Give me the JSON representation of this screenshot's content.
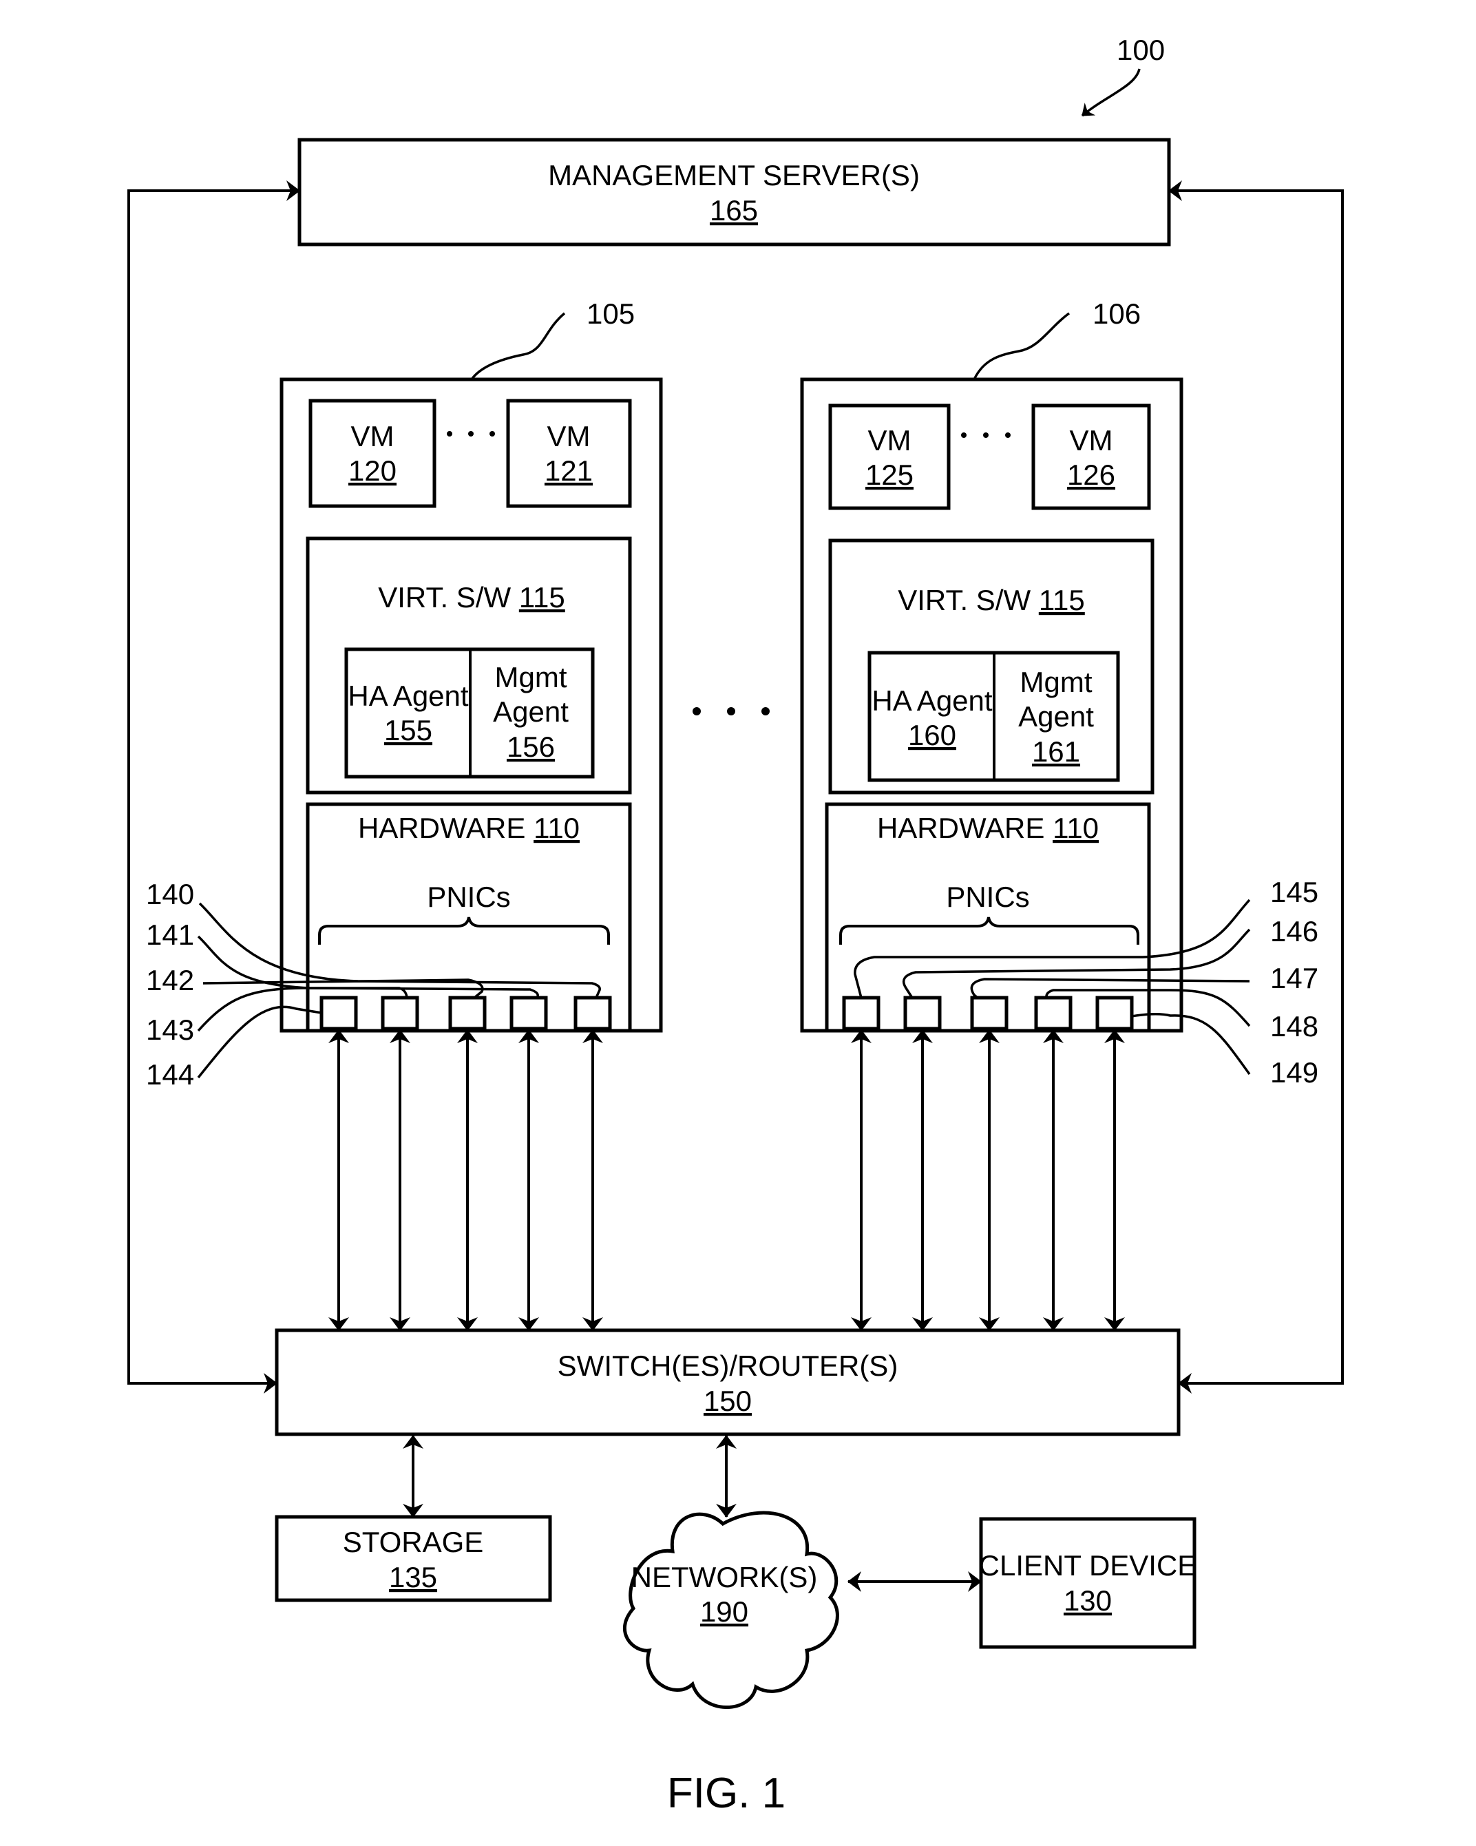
{
  "figure": {
    "ref": "100",
    "caption": "FIG. 1"
  },
  "management": {
    "title": "MANAGEMENT SERVER(S)",
    "ref": "165"
  },
  "hosts": [
    {
      "ref": "105",
      "vms": [
        {
          "title": "VM",
          "ref": "120"
        },
        {
          "title": "VM",
          "ref": "121"
        }
      ],
      "virt": {
        "title": "VIRT. S/W ",
        "ref": "115"
      },
      "ha_agent": {
        "title": "HA Agent",
        "ref": "155"
      },
      "mgmt_agent": {
        "title1": "Mgmt",
        "title2": "Agent",
        "ref": "156"
      },
      "hardware": {
        "title": "HARDWARE ",
        "ref": "110"
      },
      "pnics_label": "PNICs",
      "pnic_refs": [
        "140",
        "141",
        "142",
        "143",
        "144"
      ]
    },
    {
      "ref": "106",
      "vms": [
        {
          "title": "VM",
          "ref": "125"
        },
        {
          "title": "VM",
          "ref": "126"
        }
      ],
      "virt": {
        "title": "VIRT. S/W ",
        "ref": "115"
      },
      "ha_agent": {
        "title": "HA Agent",
        "ref": "160"
      },
      "mgmt_agent": {
        "title1": "Mgmt",
        "title2": "Agent",
        "ref": "161"
      },
      "hardware": {
        "title": "HARDWARE ",
        "ref": "110"
      },
      "pnics_label": "PNICs",
      "pnic_refs": [
        "145",
        "146",
        "147",
        "148",
        "149"
      ]
    }
  ],
  "switch": {
    "title": "SWITCH(ES)/ROUTER(S)",
    "ref": "150"
  },
  "storage": {
    "title": "STORAGE",
    "ref": "135"
  },
  "network": {
    "title": "NETWORK(S)",
    "ref": "190"
  },
  "client": {
    "title": "CLIENT DEVICE",
    "ref": "130"
  }
}
